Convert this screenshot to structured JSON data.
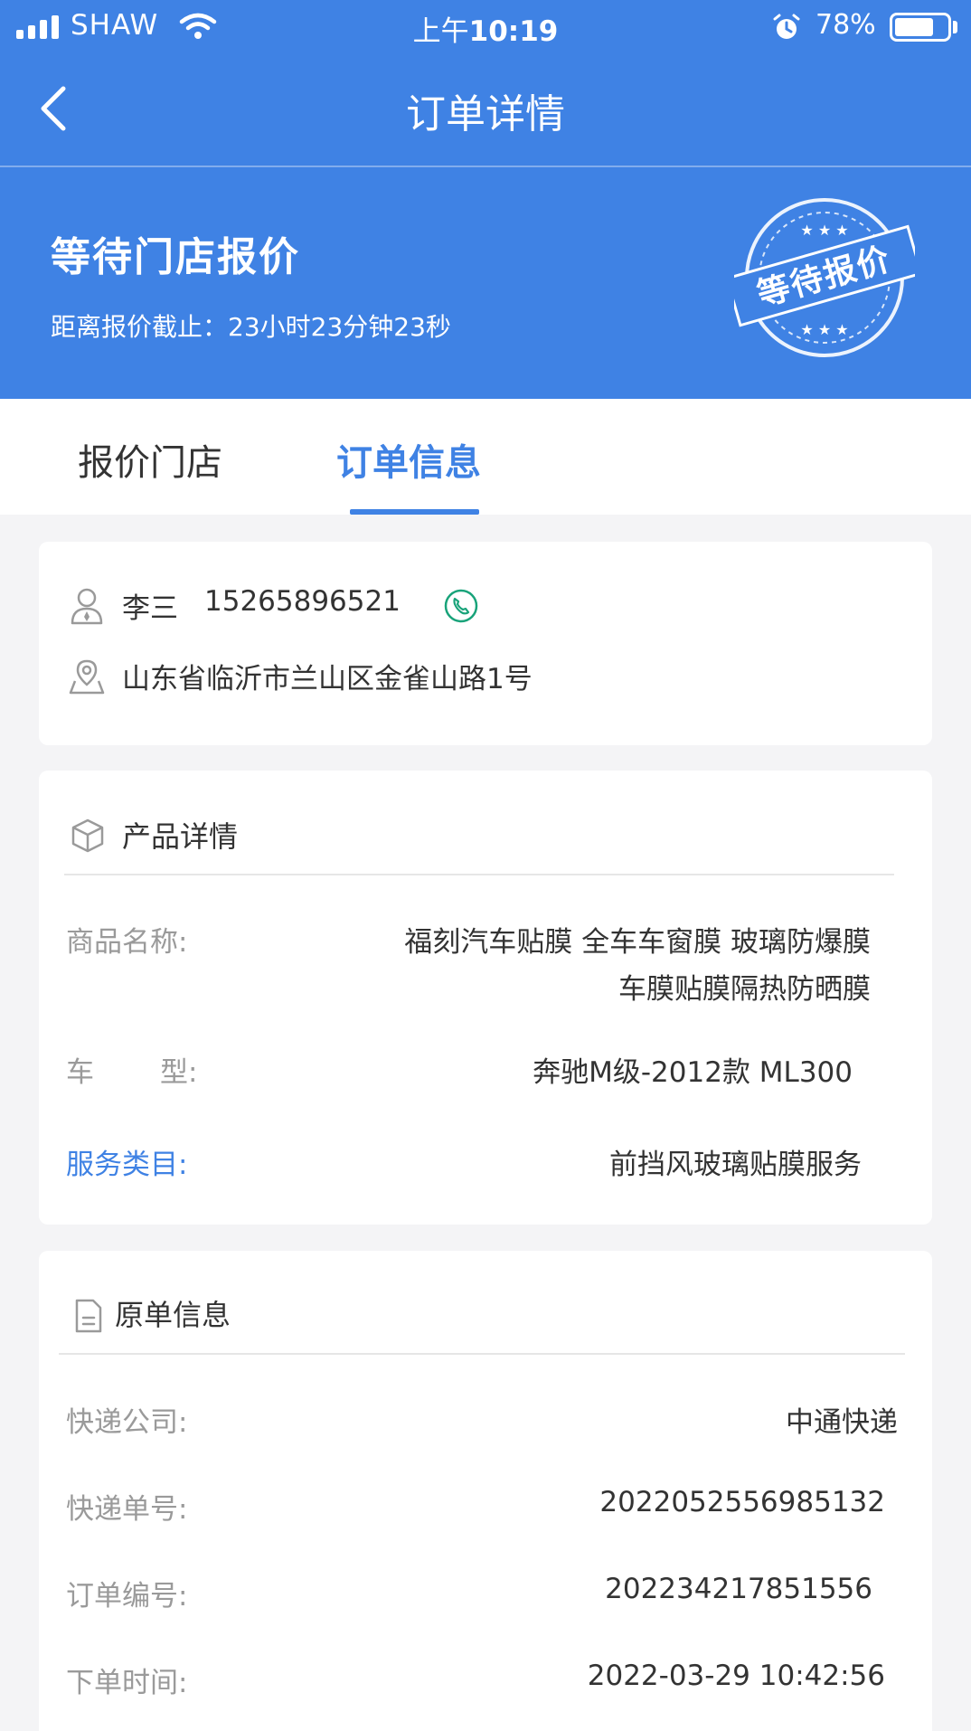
{
  "status_bar": {
    "carrier": "SHAW",
    "time_prefix": "上午",
    "time": "10:19",
    "battery": "78%",
    "battery_level": 0.78
  },
  "nav": {
    "title": "订单详情"
  },
  "order_status": {
    "title": "等待门店报价",
    "countdown": "距离报价截止：23小时23分钟23秒",
    "stamp_text": "等待报价"
  },
  "tabs": [
    {
      "label": "报价门店",
      "active": false
    },
    {
      "label": "订单信息",
      "active": true
    }
  ],
  "contact": {
    "name": "李三",
    "phone": "15265896521",
    "address": "山东省临沂市兰山区金雀山路1号"
  },
  "product": {
    "section_title": "产品详情",
    "name_label": "商品名称:",
    "name_line1": "福刻汽车贴膜 全车车窗膜 玻璃防爆膜",
    "name_line2": "车膜贴膜隔热防晒膜",
    "model_label_a": "车",
    "model_label_b": "型:",
    "model_value": "奔驰M级-2012款 ML300",
    "service_label": "服务类目:",
    "service_value": "前挡风玻璃贴膜服务"
  },
  "origin": {
    "section_title": "原单信息",
    "rows": [
      {
        "label": "快递公司:",
        "value": "中通快递"
      },
      {
        "label": "快递单号:",
        "value": "2022052556985132"
      },
      {
        "label": "订单编号:",
        "value": "202234217851556"
      },
      {
        "label": "下单时间:",
        "value": "2022-03-29 10:42:56"
      }
    ]
  },
  "colors": {
    "primary": "#3f82e4",
    "page_bg": "#f4f4f6",
    "phone_green": "#19a37a"
  }
}
